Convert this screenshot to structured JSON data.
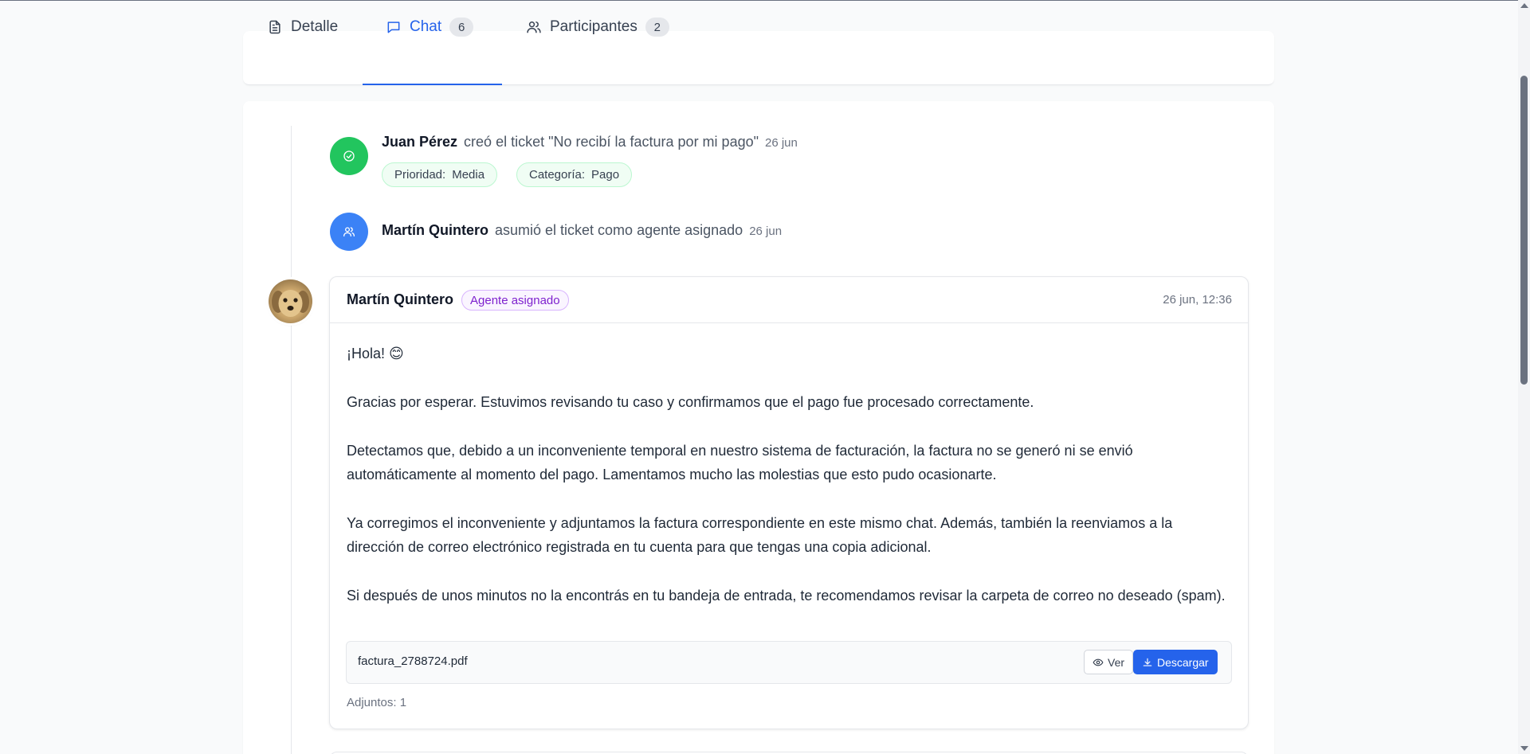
{
  "tabs": [
    {
      "label": "Detalle",
      "icon": "document-icon"
    },
    {
      "label": "Chat",
      "count": "6",
      "icon": "chat-icon",
      "active": true
    },
    {
      "label": "Participantes",
      "count": "2",
      "icon": "users-icon"
    }
  ],
  "events": [
    {
      "who": "Juan Pérez",
      "action": "creó el ticket \"No recibí la factura por mi pago\"",
      "when": "26 jun",
      "icon": "check-circle-icon",
      "color": "#22c55e",
      "chips": [
        {
          "key": "Prioridad:",
          "value": "Media"
        },
        {
          "key": "Categoría:",
          "value": "Pago"
        }
      ]
    },
    {
      "who": "Martín Quintero",
      "action": "asumió el ticket como agente asignado",
      "when": "26 jun",
      "icon": "users-icon",
      "color": "#3b82f6"
    }
  ],
  "message": {
    "author": "Martín Quintero",
    "badge": "Agente asignado",
    "time": "26 jun, 12:36",
    "paragraphs": [
      "¡Hola! 😊",
      "Gracias por esperar. Estuvimos revisando tu caso y confirmamos que el pago fue procesado correctamente.",
      "Detectamos que, debido a un inconveniente temporal en nuestro sistema de facturación, la factura no se generó ni se envió automáticamente al momento del pago. Lamentamos mucho las molestias que esto pudo ocasionarte.",
      "Ya corregimos el inconveniente y adjuntamos la factura correspondiente en este mismo chat. Además, también la reenviamos a la dirección de correo electrónico registrada en tu cuenta para que tengas una copia adicional.",
      "Si después de unos minutos no la encontrás en tu bandeja de entrada, te recomendamos revisar la carpeta de correo no deseado (spam)."
    ],
    "attachment": {
      "filename": "factura_2788724.pdf",
      "view_label": "Ver",
      "download_label": "Descargar"
    },
    "attachments_count": "Adjuntos: 1"
  },
  "colors": {
    "accent": "#2563eb",
    "success": "#22c55e",
    "badge_purple": "#7e22ce"
  }
}
